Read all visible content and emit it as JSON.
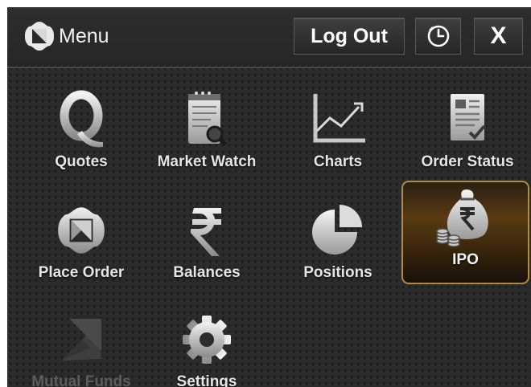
{
  "header": {
    "brand_icon": "brand-logo-icon",
    "title": "Menu",
    "logout_label": "Log Out",
    "history_icon": "clock-icon",
    "close_label": "X"
  },
  "menu": {
    "items": [
      {
        "label": "Quotes",
        "icon": "quotes-q-icon",
        "selected": false,
        "disabled": false
      },
      {
        "label": "Market Watch",
        "icon": "notepad-magnifier-icon",
        "selected": false,
        "disabled": false
      },
      {
        "label": "Charts",
        "icon": "line-chart-icon",
        "selected": false,
        "disabled": false
      },
      {
        "label": "Order Status",
        "icon": "document-check-icon",
        "selected": false,
        "disabled": false
      },
      {
        "label": "Place Order",
        "icon": "place-order-logo-icon",
        "selected": false,
        "disabled": false
      },
      {
        "label": "Balances",
        "icon": "rupee-icon",
        "selected": false,
        "disabled": false
      },
      {
        "label": "Positions",
        "icon": "pie-chart-icon",
        "selected": false,
        "disabled": false
      },
      {
        "label": "IPO",
        "icon": "money-bag-rupee-icon",
        "selected": true,
        "disabled": false
      },
      {
        "label": "Mutual Funds",
        "icon": "growth-arrow-icon",
        "selected": false,
        "disabled": true
      },
      {
        "label": "Settings",
        "icon": "gear-icon",
        "selected": false,
        "disabled": false
      }
    ]
  },
  "colors": {
    "background": "#2b2b2b",
    "selected_border": "#b48a3c",
    "selected_fill": "#5a3a12",
    "label_text": "#e6e6e6",
    "disabled_text": "#5c5c5c"
  }
}
